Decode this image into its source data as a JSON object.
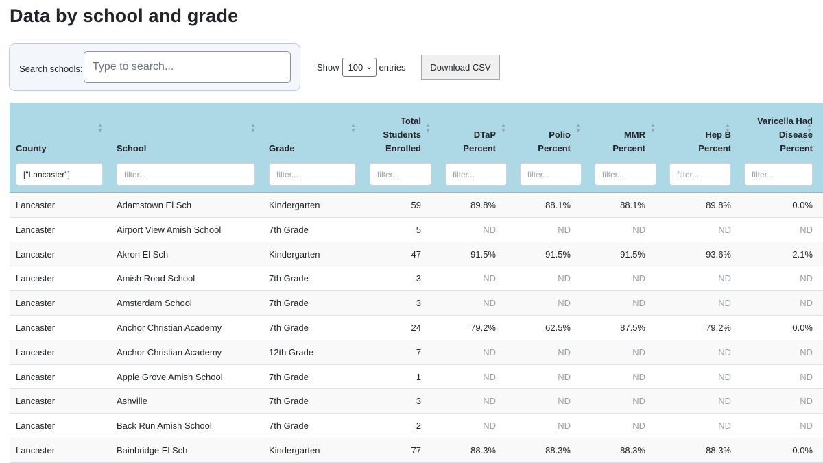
{
  "page": {
    "title": "Data by school and grade"
  },
  "search": {
    "label": "Search schools:",
    "placeholder": "Type to search..."
  },
  "length": {
    "prefix": "Show",
    "value": "100",
    "suffix": "entries"
  },
  "download": {
    "label": "Download CSV"
  },
  "table": {
    "columns": [
      {
        "key": "county",
        "lines": [
          "County"
        ],
        "align": "left",
        "filter_value": "[\"Lancaster\"]",
        "filter_placeholder": "filter..."
      },
      {
        "key": "school",
        "lines": [
          "School"
        ],
        "align": "left",
        "filter_value": "",
        "filter_placeholder": "filter..."
      },
      {
        "key": "grade",
        "lines": [
          "Grade"
        ],
        "align": "left",
        "filter_value": "",
        "filter_placeholder": "filter..."
      },
      {
        "key": "total",
        "lines": [
          "Total",
          "Students",
          "Enrolled"
        ],
        "align": "right",
        "filter_value": "",
        "filter_placeholder": "filter..."
      },
      {
        "key": "dtap",
        "lines": [
          "DTaP",
          "Percent"
        ],
        "align": "right",
        "filter_value": "",
        "filter_placeholder": "filter..."
      },
      {
        "key": "polio",
        "lines": [
          "Polio",
          "Percent"
        ],
        "align": "right",
        "filter_value": "",
        "filter_placeholder": "filter..."
      },
      {
        "key": "mmr",
        "lines": [
          "MMR",
          "Percent"
        ],
        "align": "right",
        "filter_value": "",
        "filter_placeholder": "filter..."
      },
      {
        "key": "hepb",
        "lines": [
          "Hep B",
          "Percent"
        ],
        "align": "right",
        "filter_value": "",
        "filter_placeholder": "filter..."
      },
      {
        "key": "varicella",
        "lines": [
          "Varicella Had",
          "Disease",
          "Percent"
        ],
        "align": "right",
        "filter_value": "",
        "filter_placeholder": "filter..."
      }
    ],
    "no_data_marker": "ND",
    "rows": [
      [
        "Lancaster",
        "Adamstown El Sch",
        "Kindergarten",
        "59",
        "89.8%",
        "88.1%",
        "88.1%",
        "89.8%",
        "0.0%"
      ],
      [
        "Lancaster",
        "Airport View Amish School",
        "7th Grade",
        "5",
        "ND",
        "ND",
        "ND",
        "ND",
        "ND"
      ],
      [
        "Lancaster",
        "Akron El Sch",
        "Kindergarten",
        "47",
        "91.5%",
        "91.5%",
        "91.5%",
        "93.6%",
        "2.1%"
      ],
      [
        "Lancaster",
        "Amish Road School",
        "7th Grade",
        "3",
        "ND",
        "ND",
        "ND",
        "ND",
        "ND"
      ],
      [
        "Lancaster",
        "Amsterdam School",
        "7th Grade",
        "3",
        "ND",
        "ND",
        "ND",
        "ND",
        "ND"
      ],
      [
        "Lancaster",
        "Anchor Christian Academy",
        "7th Grade",
        "24",
        "79.2%",
        "62.5%",
        "87.5%",
        "79.2%",
        "0.0%"
      ],
      [
        "Lancaster",
        "Anchor Christian Academy",
        "12th Grade",
        "7",
        "ND",
        "ND",
        "ND",
        "ND",
        "ND"
      ],
      [
        "Lancaster",
        "Apple Grove Amish School",
        "7th Grade",
        "1",
        "ND",
        "ND",
        "ND",
        "ND",
        "ND"
      ],
      [
        "Lancaster",
        "Ashville",
        "7th Grade",
        "3",
        "ND",
        "ND",
        "ND",
        "ND",
        "ND"
      ],
      [
        "Lancaster",
        "Back Run Amish School",
        "7th Grade",
        "2",
        "ND",
        "ND",
        "ND",
        "ND",
        "ND"
      ],
      [
        "Lancaster",
        "Bainbridge El Sch",
        "Kindergarten",
        "77",
        "88.3%",
        "88.3%",
        "88.3%",
        "88.3%",
        "0.0%"
      ]
    ]
  }
}
